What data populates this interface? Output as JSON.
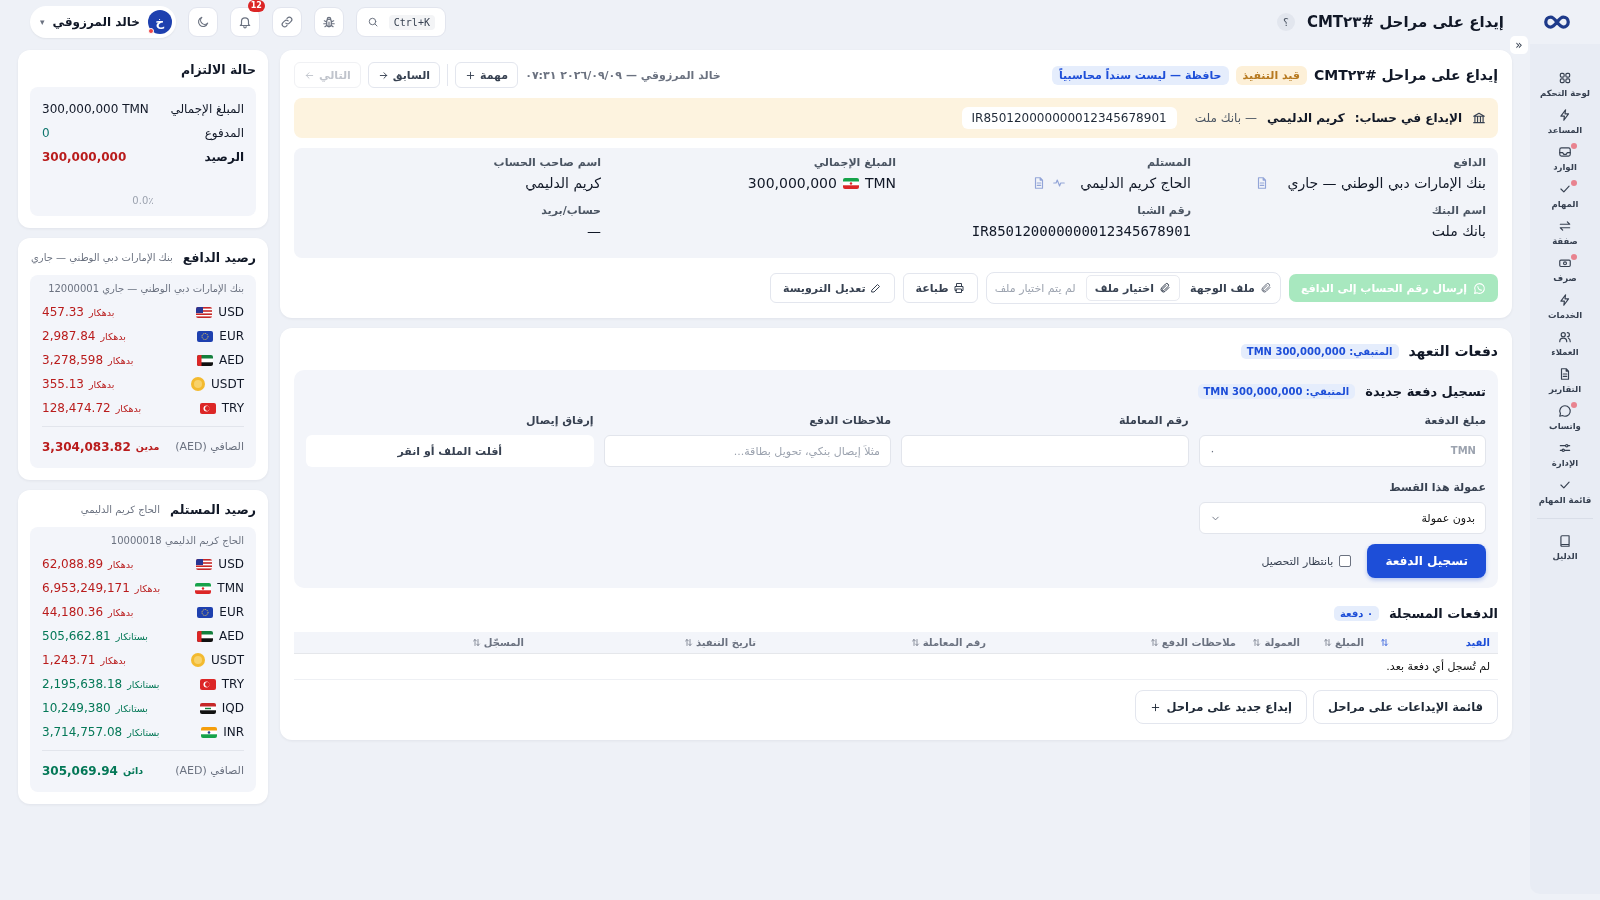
{
  "topbar": {
    "title": "إيداع على مراحل #CMT٢٣",
    "help": "؟",
    "search_shortcut": "Ctrl+K",
    "notifications": "12",
    "user": {
      "name": "خالد المرزوقي",
      "initial": "خ",
      "caret": "▾"
    }
  },
  "sidebar": {
    "collapse": "«",
    "items": [
      {
        "label": "لوحة التحكم",
        "kind": "dashboard",
        "dot": false,
        "separated": false
      },
      {
        "label": "المساعد",
        "kind": "assistant",
        "dot": false,
        "separated": false
      },
      {
        "label": "الوارد",
        "kind": "inbox",
        "dot": true,
        "separated": false
      },
      {
        "label": "المهام",
        "kind": "tasks",
        "dot": true,
        "separated": false
      },
      {
        "label": "صفقة",
        "kind": "deal",
        "dot": false,
        "separated": false
      },
      {
        "label": "صرف",
        "kind": "payout",
        "dot": true,
        "separated": false
      },
      {
        "label": "الخدمات",
        "kind": "services",
        "dot": false,
        "separated": false
      },
      {
        "label": "العملاء",
        "kind": "clients",
        "dot": false,
        "separated": false
      },
      {
        "label": "التقارير",
        "kind": "reports",
        "dot": false,
        "separated": false
      },
      {
        "label": "واتساب",
        "kind": "chat",
        "dot": true,
        "separated": false
      },
      {
        "label": "الإدارة",
        "kind": "admin",
        "dot": false,
        "separated": false
      },
      {
        "label": "قائمة المهام",
        "kind": "checklist",
        "dot": false,
        "separated": false
      },
      {
        "label": "الدليل",
        "kind": "guide",
        "dot": false,
        "separated": true
      }
    ]
  },
  "deposit": {
    "title": "إيداع على مراحل #CMT٢٣",
    "badges": [
      {
        "label": "قيد التنفيذ",
        "kind": "status"
      },
      {
        "label": "حافظة — ليست سنداً محاسبياً",
        "kind": "info"
      }
    ],
    "meta": "خالد المرزوقي — ٢٠٢٦/٠٩/٠٩ ٠٧:٣١",
    "task_button": "مهمة",
    "prev": {
      "label": "السابق",
      "disabled": false
    },
    "next": {
      "label": "التالي",
      "disabled": true
    },
    "banner": {
      "label": "الإيداع في حساب:",
      "holder": "كريم الدليمي",
      "bank": "— بانك ملت",
      "iban": "IR850120000000012345678901"
    },
    "details": [
      {
        "label": "الدافع",
        "value": "بنك الإمارات دبي الوطني — جاري",
        "kind": "party"
      },
      {
        "label": "المستلم",
        "value": "الحاج كريم الدليمي",
        "kind": "party_activity"
      },
      {
        "label": "المبلغ الإجمالي",
        "value": "300,000,000",
        "currency": {
          "code": "TMN",
          "kind": "ir"
        },
        "kind": "amount"
      },
      {
        "label": "اسم صاحب الحساب",
        "value": "كريم الدليمي",
        "kind": "text"
      },
      {
        "label": "اسم البنك",
        "value": "بانك ملت",
        "kind": "text"
      },
      {
        "label": "رقم الشبا",
        "value": "IR850120000000012345678901",
        "kind": "iban"
      },
      {
        "label": "حساب/بريد",
        "value": "—",
        "kind": "ltr"
      }
    ],
    "actions": {
      "whatsapp": {
        "label": "إرسال رقم الحساب إلى الدافع",
        "disabled": true
      },
      "file_label": "ملف الوجهة",
      "file_button": "اختيار ملف",
      "file_status": "لم يتم اختيار ملف",
      "print": "طباعة",
      "edit_header": "تعديل الترويسة"
    }
  },
  "payments": {
    "title": "دفعات التعهد",
    "remaining": "المتبقي: TMN 300,000,000",
    "form": {
      "title": "تسجيل دفعة جديدة",
      "remaining": "المتبقي: TMN 300,000,000",
      "fields": [
        {
          "label": "مبلغ الدفعة",
          "kind": "amount",
          "prefix": "TMN",
          "placeholder": "٠"
        },
        {
          "label": "رقم المعاملة",
          "kind": "text"
        },
        {
          "label": "ملاحظات الدفع",
          "kind": "text",
          "placeholder": "مثلاً إيصال بنكي، تحويل بطاقة..."
        },
        {
          "label": "إرفاق إيصال",
          "kind": "file",
          "prompt": "أفلت الملف أو انقر"
        }
      ],
      "commission": {
        "label": "عمولة هذا القسط",
        "value": "بدون عمولة"
      },
      "submit": "تسجيل الدفعة",
      "pending": {
        "label": "بانتظار التحصيل",
        "checked": false
      }
    },
    "recorded": {
      "title": "الدفعات المسجلة",
      "count": "٠ دفعة",
      "columns": [
        {
          "label": "القيد",
          "selected": true
        },
        {
          "label": "المبلغ",
          "selected": false
        },
        {
          "label": "العمولة",
          "selected": false
        },
        {
          "label": "ملاحظات الدفع",
          "selected": false
        },
        {
          "label": "رقم المعاملة",
          "selected": false
        },
        {
          "label": "تاريخ التنفيذ",
          "selected": false
        },
        {
          "label": "المسجّل",
          "selected": false
        }
      ],
      "empty": "لم تُسجل أي دفعة بعد."
    },
    "footer_buttons": [
      {
        "label": "قائمة الإيداعات على مراحل",
        "kind": "list"
      },
      {
        "label": "إيداع جديد على مراحل",
        "kind": "new"
      }
    ]
  },
  "commitment": {
    "title": "حالة الالتزام",
    "rows": [
      {
        "label": "المبلغ الإجمالي",
        "value": "300,000,000 TMN",
        "kind": "plain"
      },
      {
        "label": "المدفوع",
        "value": "0",
        "kind": "paid"
      },
      {
        "label": "الرصيد",
        "value": "300,000,000",
        "kind": "balance"
      }
    ],
    "progress": {
      "reading": "0.0٪"
    }
  },
  "payer_balance": {
    "title": "رصيد الدافع",
    "subtitle": "بنك الإمارات دبي الوطني — جاري",
    "account": "بنك الإمارات دبي الوطني — جاري 12000001",
    "rows": [
      {
        "currency": {
          "code": "USD",
          "kind": "us"
        },
        "side": {
          "label": "بدهكار",
          "kind": "debit"
        },
        "amount": "457.33"
      },
      {
        "currency": {
          "code": "EUR",
          "kind": "eu"
        },
        "side": {
          "label": "بدهكار",
          "kind": "debit"
        },
        "amount": "2,987.84"
      },
      {
        "currency": {
          "code": "AED",
          "kind": "ae"
        },
        "side": {
          "label": "بدهكار",
          "kind": "debit"
        },
        "amount": "3,278,598"
      },
      {
        "currency": {
          "code": "USDT",
          "kind": "coin"
        },
        "side": {
          "label": "بدهكار",
          "kind": "debit"
        },
        "amount": "355.13"
      },
      {
        "currency": {
          "code": "TRY",
          "kind": "tr"
        },
        "side": {
          "label": "بدهكار",
          "kind": "debit"
        },
        "amount": "128,474.72"
      }
    ],
    "net": {
      "label": "الصافي (AED)",
      "amount": "3,304,083.82",
      "side": {
        "label": "مدين",
        "kind": "debit"
      }
    }
  },
  "payee_balance": {
    "title": "رصيد المستلم",
    "subtitle": "الحاج كريم الدليمي",
    "account": "الحاج كريم الدليمي 10000018",
    "rows": [
      {
        "currency": {
          "code": "USD",
          "kind": "us"
        },
        "side": {
          "label": "بدهكار",
          "kind": "debit"
        },
        "amount": "62,088.89"
      },
      {
        "currency": {
          "code": "TMN",
          "kind": "ir"
        },
        "side": {
          "label": "بدهكار",
          "kind": "debit"
        },
        "amount": "6,953,249,171"
      },
      {
        "currency": {
          "code": "EUR",
          "kind": "eu"
        },
        "side": {
          "label": "بدهكار",
          "kind": "debit"
        },
        "amount": "44,180.36"
      },
      {
        "currency": {
          "code": "AED",
          "kind": "ae"
        },
        "side": {
          "label": "بستانكار",
          "kind": "credit"
        },
        "amount": "505,662.81"
      },
      {
        "currency": {
          "code": "USDT",
          "kind": "coin"
        },
        "side": {
          "label": "بدهكار",
          "kind": "debit"
        },
        "amount": "1,243.71"
      },
      {
        "currency": {
          "code": "TRY",
          "kind": "tr"
        },
        "side": {
          "label": "بستانكار",
          "kind": "credit"
        },
        "amount": "2,195,638.18"
      },
      {
        "currency": {
          "code": "IQD",
          "kind": "iq"
        },
        "side": {
          "label": "بستانكار",
          "kind": "credit"
        },
        "amount": "10,249,380"
      },
      {
        "currency": {
          "code": "INR",
          "kind": "in"
        },
        "side": {
          "label": "بستانكار",
          "kind": "credit"
        },
        "amount": "3,714,757.08"
      }
    ],
    "net": {
      "label": "الصافي (AED)",
      "amount": "305,069.94",
      "side": {
        "label": "دائن",
        "kind": "credit"
      }
    }
  }
}
